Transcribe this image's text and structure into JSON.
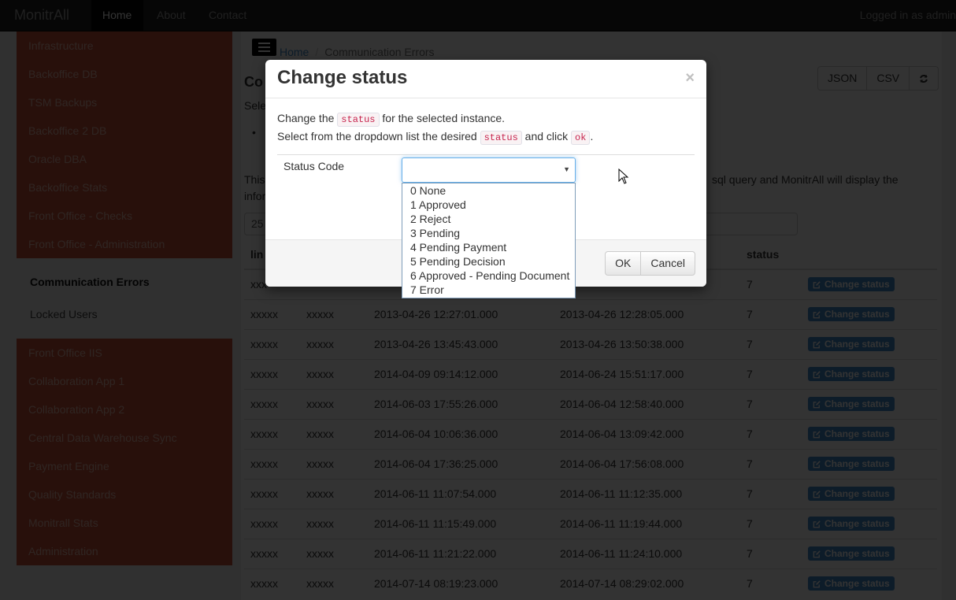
{
  "navbar": {
    "brand": "MonitrAll",
    "items": [
      "Home",
      "About",
      "Contact"
    ],
    "active": "Home",
    "user_text": "Logged in as admin"
  },
  "sidebar": {
    "group1": [
      "Infrastructure",
      "Backoffice DB",
      "TSM Backups",
      "Backoffice 2 DB",
      "Oracle DBA",
      "Backoffice Stats",
      "Front Office - Checks",
      "Front Office - Administration"
    ],
    "sub": [
      "Communication Errors",
      "Locked Users"
    ],
    "sub_active": "Communication Errors",
    "group2": [
      "Front Office IIS",
      "Collaboration App 1",
      "Collaboration App 2",
      "Central Data Warehouse Sync",
      "Payment Engine",
      "Quality Standards",
      "Monitrall Stats",
      "Administration"
    ]
  },
  "breadcrumb": {
    "home": "Home",
    "current": "Communication Errors"
  },
  "page": {
    "title_partial": "Co",
    "subtitle_partial": "Sele",
    "desc_left_1": "This",
    "desc_right_1": "sql query and MonitrAll will display the",
    "desc_left_2": "infor",
    "search_value_partial": "25",
    "toolbar": {
      "json": "JSON",
      "csv": "CSV"
    }
  },
  "table": {
    "headers": [
      "lin",
      "",
      "",
      "",
      "status",
      ""
    ],
    "action_label": "Change status",
    "rows": [
      [
        "xxx",
        "",
        "",
        "",
        "7"
      ],
      [
        "xxxxx",
        "xxxxx",
        "2013-04-26 12:27:01.000",
        "2013-04-26 12:28:05.000",
        "7"
      ],
      [
        "xxxxx",
        "xxxxx",
        "2013-04-26 13:45:43.000",
        "2013-04-26 13:50:38.000",
        "7"
      ],
      [
        "xxxxx",
        "xxxxx",
        "2014-04-09 09:14:12.000",
        "2014-06-24 15:51:17.000",
        "7"
      ],
      [
        "xxxxx",
        "xxxxx",
        "2014-06-03 17:55:26.000",
        "2014-06-04 12:58:40.000",
        "7"
      ],
      [
        "xxxxx",
        "xxxxx",
        "2014-06-04 10:06:36.000",
        "2014-06-04 13:09:42.000",
        "7"
      ],
      [
        "xxxxx",
        "xxxxx",
        "2014-06-04 17:36:25.000",
        "2014-06-04 17:56:08.000",
        "7"
      ],
      [
        "xxxxx",
        "xxxxx",
        "2014-06-11 11:07:54.000",
        "2014-06-11 11:12:35.000",
        "7"
      ],
      [
        "xxxxx",
        "xxxxx",
        "2014-06-11 11:15:49.000",
        "2014-06-11 11:19:44.000",
        "7"
      ],
      [
        "xxxxx",
        "xxxxx",
        "2014-06-11 11:21:22.000",
        "2014-06-11 11:24:10.000",
        "7"
      ],
      [
        "xxxxx",
        "xxxxx",
        "2014-07-14 08:19:23.000",
        "2014-07-14 08:29:02.000",
        "7"
      ]
    ]
  },
  "modal": {
    "title": "Change status",
    "close": "×",
    "line1_pre": "Change the ",
    "line1_code": "status",
    "line1_post": " for the selected instance.",
    "line2_pre": "Select from the dropdown list the desired ",
    "line2_code": "status",
    "line2_mid": " and click ",
    "line2_code2": "ok",
    "line2_post": ".",
    "field_label": "Status Code",
    "select_value": "",
    "options": [
      "0 None",
      "1 Approved",
      "2 Reject",
      "3 Pending",
      "4 Pending Payment",
      "5 Pending Decision",
      "6 Approved - Pending Document",
      "7 Error"
    ],
    "ok": "OK",
    "cancel": "Cancel"
  }
}
